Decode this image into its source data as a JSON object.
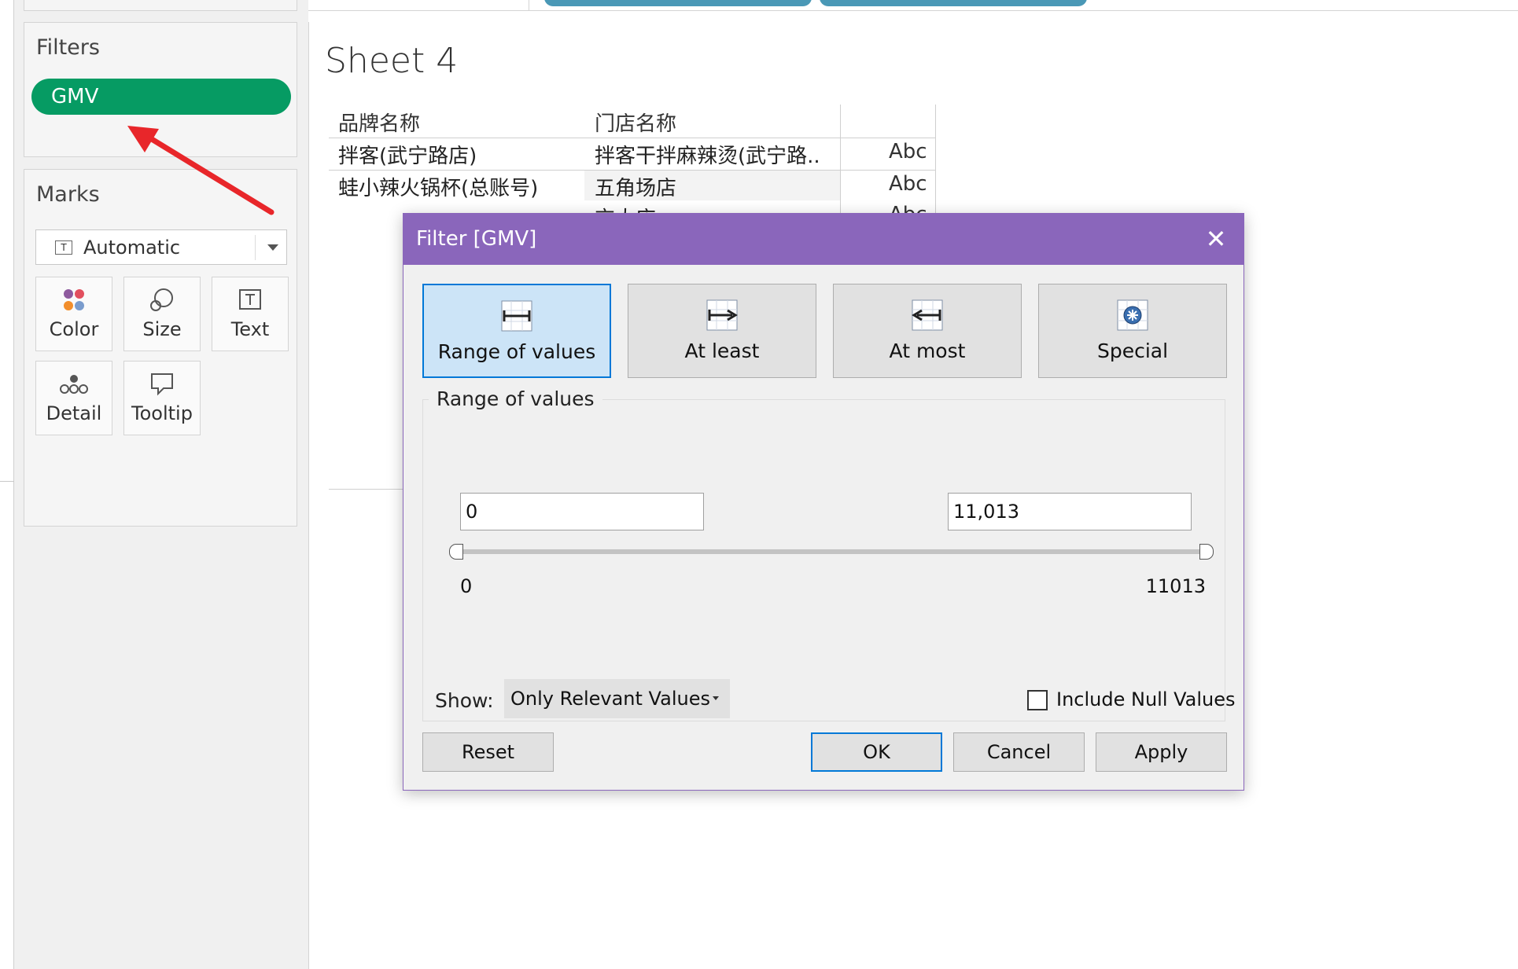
{
  "filters_panel": {
    "title": "Filters",
    "pill_label": "GMV",
    "pill_color": "#069b63"
  },
  "marks_panel": {
    "title": "Marks",
    "mark_type": "Automatic",
    "buttons": [
      {
        "label": "Color",
        "icon": "color-dots-icon"
      },
      {
        "label": "Size",
        "icon": "size-circles-icon"
      },
      {
        "label": "Text",
        "icon": "text-box-icon"
      },
      {
        "label": "Detail",
        "icon": "detail-dots-icon"
      },
      {
        "label": "Tooltip",
        "icon": "speech-bubble-icon"
      }
    ]
  },
  "sheet": {
    "title": "Sheet 4",
    "headers": [
      "品牌名称",
      "门店名称"
    ],
    "rows": [
      {
        "brand": "拌客(武宁路店)",
        "store": "拌客干拌麻辣烫(武宁路..",
        "value": "Abc"
      },
      {
        "brand": "蛙小辣火锅杯(总账号)",
        "store": "五角场店",
        "value": "Abc"
      },
      {
        "brand": "",
        "store": "交大店",
        "value": "Abc"
      }
    ]
  },
  "annotation": {
    "arrow_color": "#e8262a"
  },
  "dialog": {
    "title": "Filter [GMV]",
    "title_bar_color": "#8a66bb",
    "modes": [
      {
        "label": "Range of values",
        "icon": "range-icon",
        "active": true
      },
      {
        "label": "At least",
        "icon": "at-least-icon",
        "active": false
      },
      {
        "label": "At most",
        "icon": "at-most-icon",
        "active": false
      },
      {
        "label": "Special",
        "icon": "special-icon",
        "active": false
      }
    ],
    "group_label": "Range of values",
    "min_value": "0",
    "max_value": "11,013",
    "slider_min_label": "0",
    "slider_max_label": "11013",
    "slider_selected_fraction": [
      0.0,
      1.0
    ],
    "show_label": "Show:",
    "show_value": "Only Relevant Values",
    "include_null_label": "Include Null Values",
    "include_null_checked": false,
    "buttons": {
      "reset": "Reset",
      "ok": "OK",
      "cancel": "Cancel",
      "apply": "Apply"
    }
  }
}
